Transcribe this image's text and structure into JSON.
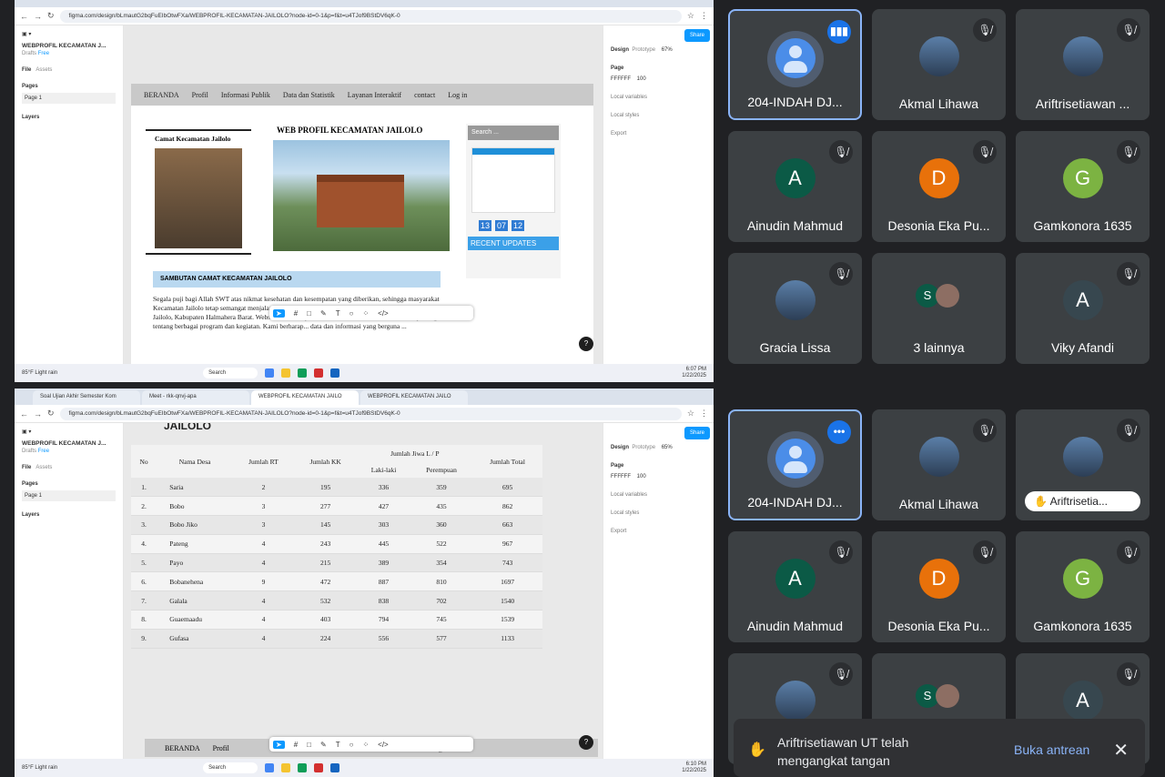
{
  "browser": {
    "url": "figma.com/design/bLmautG2bqFuEIbOtwFXa/WEBPROFIL-KECAMATAN-JAILOLO?node-id=0-1&p=f&t=u4TJof9BStDV6qK-0",
    "tabs": [
      "Soal Ujian Akhir Semester Kom",
      "Meet - rkk-qnvj-apa",
      "WEBPROFIL KECAMATAN JAILO",
      "WEBPROFIL KECAMATAN JAILO"
    ]
  },
  "figma": {
    "project": "WEBPROFIL KECAMATAN J...",
    "drafts": "Drafts",
    "free": "Free",
    "file_tab": "File",
    "assets_tab": "Assets",
    "pages_label": "Pages",
    "page1": "Page 1",
    "layers_label": "Layers",
    "design_tab": "Design",
    "prototype_tab": "Prototype",
    "zoom1": "67%",
    "zoom2": "65%",
    "share": "Share",
    "page_heading": "Page",
    "page_color": "FFFFFF",
    "opacity": "100",
    "local_variables": "Local variables",
    "local_styles": "Local styles",
    "export": "Export"
  },
  "website": {
    "menu": [
      "BERANDA",
      "Profil",
      "Informasi Publik",
      "Data dan Statistik",
      "Layanan Interaktif",
      "contact",
      "Log in"
    ],
    "title": "WEB PROFIL KECAMATAN JAILOLO",
    "camat_label": "Camat Kecamatan Jailolo",
    "search_placeholder": "Search ...",
    "time": [
      "13",
      "07",
      "12"
    ],
    "recent": "RECENT UPDATES",
    "sambutan": "SAMBUTAN CAMAT KECAMATAN JAILOLO",
    "paragraph": "Segala puji bagi Allah SWT atas nikmat kesehatan dan kesempatan yang diberikan, sehingga masyarakat Kecamatan Jailolo tetap semangat menjalani hidup sehat. Selamat datang di situs resmi Kecamatan Jailolo, Kabupaten Halmahera Barat. Website ini berisi profil Kecamatan Jailolo serta informasi penting tentang berbagai program dan kegiatan. Kami berharap... data dan informasi yang berguna ..."
  },
  "table": {
    "header_top": "JAILOLO",
    "headers": [
      "No",
      "Nama Desa",
      "Jumlah RT",
      "Jumlah KK",
      "Jumlah Jiwa L / P",
      "Jumlah Total"
    ],
    "sub_headers": [
      "Laki-laki",
      "Perempuan"
    ],
    "rows": [
      [
        "1.",
        "Saria",
        "2",
        "195",
        "336",
        "359",
        "695"
      ],
      [
        "2.",
        "Bobo",
        "3",
        "277",
        "427",
        "435",
        "862"
      ],
      [
        "3.",
        "Bobo Jiko",
        "3",
        "145",
        "303",
        "360",
        "663"
      ],
      [
        "4.",
        "Pateng",
        "4",
        "243",
        "445",
        "522",
        "967"
      ],
      [
        "5.",
        "Payo",
        "4",
        "215",
        "389",
        "354",
        "743"
      ],
      [
        "6.",
        "Bobanehena",
        "9",
        "472",
        "887",
        "810",
        "1697"
      ],
      [
        "7.",
        "Galala",
        "4",
        "532",
        "838",
        "702",
        "1540"
      ],
      [
        "8.",
        "Guaemaadu",
        "4",
        "403",
        "794",
        "745",
        "1539"
      ],
      [
        "9.",
        "Gufasa",
        "4",
        "224",
        "556",
        "577",
        "1133"
      ]
    ]
  },
  "taskbar": {
    "weather_temp": "85°F",
    "weather_text": "Light rain",
    "search": "Search",
    "time1": "6:07 PM",
    "time2": "6:10 PM",
    "date": "1/22/2025"
  },
  "meet": {
    "participants_top": [
      {
        "name": "204-INDAH DJ...",
        "avatar": "person",
        "mic": "speaking"
      },
      {
        "name": "Akmal Lihawa",
        "avatar": "photo",
        "mic": "muted"
      },
      {
        "name": "Ariftrisetiawan ...",
        "avatar": "photo",
        "mic": "muted"
      },
      {
        "name": "Ainudin Mahmud",
        "letter": "A",
        "color": "#0b5a46",
        "mic": "muted"
      },
      {
        "name": "Desonia Eka Pu...",
        "letter": "D",
        "color": "#e8710a",
        "mic": "muted"
      },
      {
        "name": "Gamkonora 1635",
        "letter": "G",
        "color": "#7cb342",
        "mic": "muted"
      },
      {
        "name": "Gracia Lissa",
        "avatar": "photo",
        "mic": "muted"
      },
      {
        "name": "3 lainnya",
        "letter": "S",
        "color": "#0b5a46",
        "mic": "none"
      },
      {
        "name": "Viky Afandi",
        "letter": "A",
        "color": "#37474f",
        "mic": "muted"
      }
    ],
    "participants_bottom": [
      {
        "name": "204-INDAH DJ...",
        "avatar": "person",
        "mic": "more"
      },
      {
        "name": "Akmal Lihawa",
        "avatar": "photo",
        "mic": "muted"
      },
      {
        "name": "Ariftrisetia...",
        "avatar": "photo",
        "mic": "muted",
        "hand": true
      },
      {
        "name": "Ainudin Mahmud",
        "letter": "A",
        "color": "#0b5a46",
        "mic": "muted"
      },
      {
        "name": "Desonia Eka Pu...",
        "letter": "D",
        "color": "#e8710a",
        "mic": "muted"
      },
      {
        "name": "Gamkonora 1635",
        "letter": "G",
        "color": "#7cb342",
        "mic": "muted"
      },
      {
        "name": "",
        "avatar": "photo",
        "mic": "muted"
      },
      {
        "name": "",
        "letter": "S",
        "color": "#0b5a46",
        "mic": "none"
      },
      {
        "name": "",
        "letter": "A",
        "color": "#37474f",
        "mic": "muted"
      }
    ],
    "toast": {
      "message": "Ariftrisetiawan UT telah mengangkat tangan",
      "action": "Buka antrean"
    }
  }
}
